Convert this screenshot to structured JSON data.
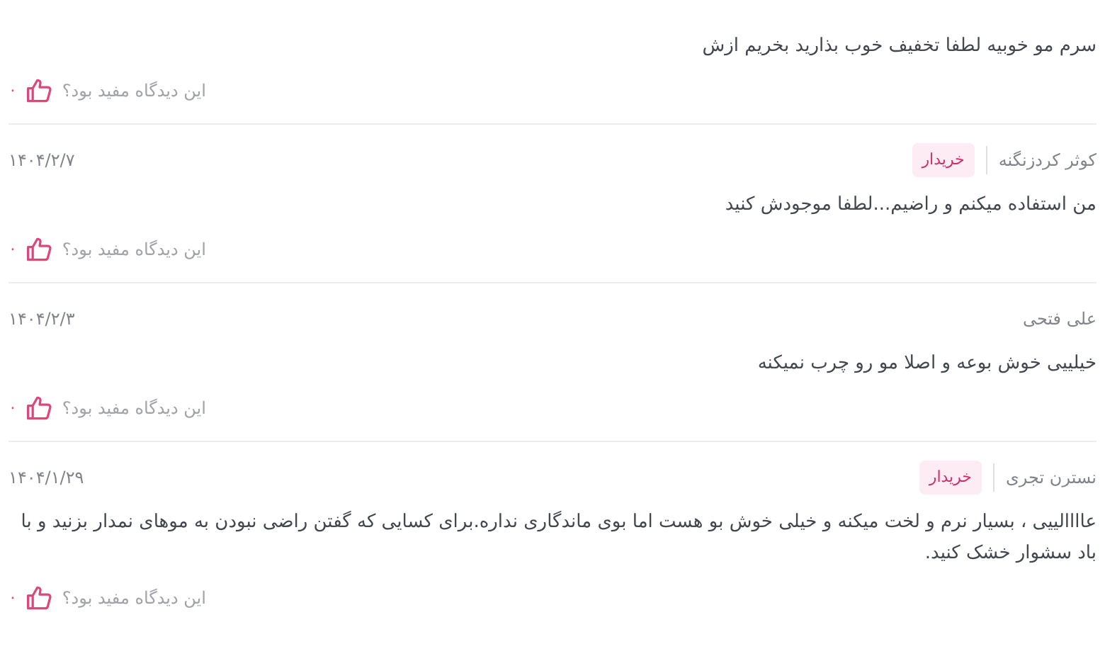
{
  "reviews": [
    {
      "text": "سرم مو خوبیه لطفا تخفیف خوب بذارید بخریم ازش",
      "helpful_prompt": "این دیدگاه مفید بود؟",
      "likes": "۰"
    },
    {
      "author": "کوثر کردزنگنه",
      "badge": "خریدار",
      "date": "۱۴۰۴/۲/۷",
      "text": "من استفاده میکنم و راضیم...لطفا موجودش کنید",
      "helpful_prompt": "این دیدگاه مفید بود؟",
      "likes": "۰"
    },
    {
      "author": "علی فتحی",
      "date": "۱۴۰۴/۲/۳",
      "text": "خیلییی خوش بوعه و اصلا مو رو چرب نمیکنه",
      "helpful_prompt": "این دیدگاه مفید بود؟",
      "likes": "۰"
    },
    {
      "author": "نسترن تجری",
      "badge": "خریدار",
      "date": "۱۴۰۴/۱/۲۹",
      "text": "عاااالییی ، بسیار نرم و لخت میکنه و خیلی خوش بو هست اما بوی ماندگاری نداره.برای کسایی که گفتن راضی نبودن به موهای نمدار بزنید و با باد سشوار خشک کنید.",
      "helpful_prompt": "این دیدگاه مفید بود؟",
      "likes": "۰"
    }
  ]
}
